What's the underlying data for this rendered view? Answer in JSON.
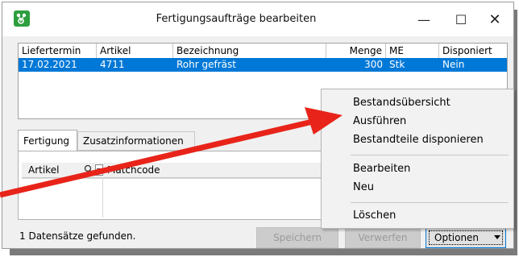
{
  "window": {
    "title": "Fertigungsaufträge bearbeiten",
    "minimize_glyph": "—",
    "maximize_glyph": "☐",
    "close_glyph": "✕",
    "app_icon": "app-logo-icon"
  },
  "grid": {
    "columns": [
      "Liefertermin",
      "Artikel",
      "Bezeichnung",
      "Menge",
      "ME",
      "Disponiert"
    ],
    "rows": [
      [
        "17.02.2021",
        "4711",
        "Rohr gefräst",
        "300",
        "Stk",
        "Nein"
      ]
    ]
  },
  "tabs": [
    "Fertigung",
    "Zusatzinformationen"
  ],
  "subgrid": {
    "columns": [
      "Artikel",
      "Matchcode"
    ]
  },
  "status": "1 Datensätze gefunden.",
  "buttons": {
    "save": "Speichern",
    "discard": "Verwerfen",
    "options": "Optionen"
  },
  "menu": {
    "items": [
      "Bestandsübersicht",
      "Ausführen",
      "Bestandteile disponieren",
      "Bearbeiten",
      "Neu",
      "Löschen"
    ]
  },
  "colors": {
    "selection": "#0078d7",
    "annotation_arrow": "#e8241a"
  }
}
